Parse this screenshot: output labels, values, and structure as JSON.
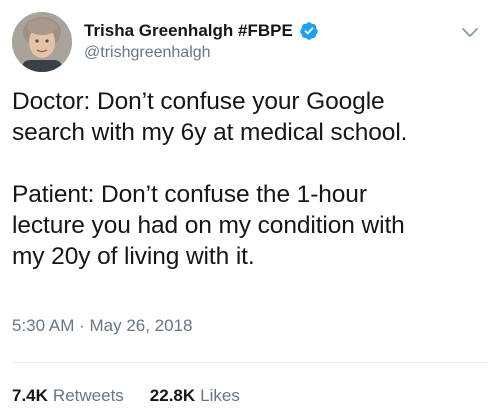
{
  "author": {
    "display_name": "Trisha Greenhalgh #FBPE",
    "handle": "@trishgreenhalgh",
    "verified": true,
    "verified_icon": "verified-badge-icon"
  },
  "tweet": {
    "text": "Doctor: Don’t confuse your Google\nsearch with my 6y at medical school.\n\nPatient: Don’t confuse the 1-hour\nlecture you had on my condition with\nmy 20y of living with it.",
    "timestamp": "5:30 AM · May 26, 2018"
  },
  "stats": {
    "retweets_count": "7.4K",
    "retweets_label": "Retweets",
    "likes_count": "22.8K",
    "likes_label": "Likes"
  },
  "colors": {
    "text": "#14171a",
    "secondary": "#657786",
    "accent": "#1da1f2",
    "divider": "#e6ecf0"
  }
}
